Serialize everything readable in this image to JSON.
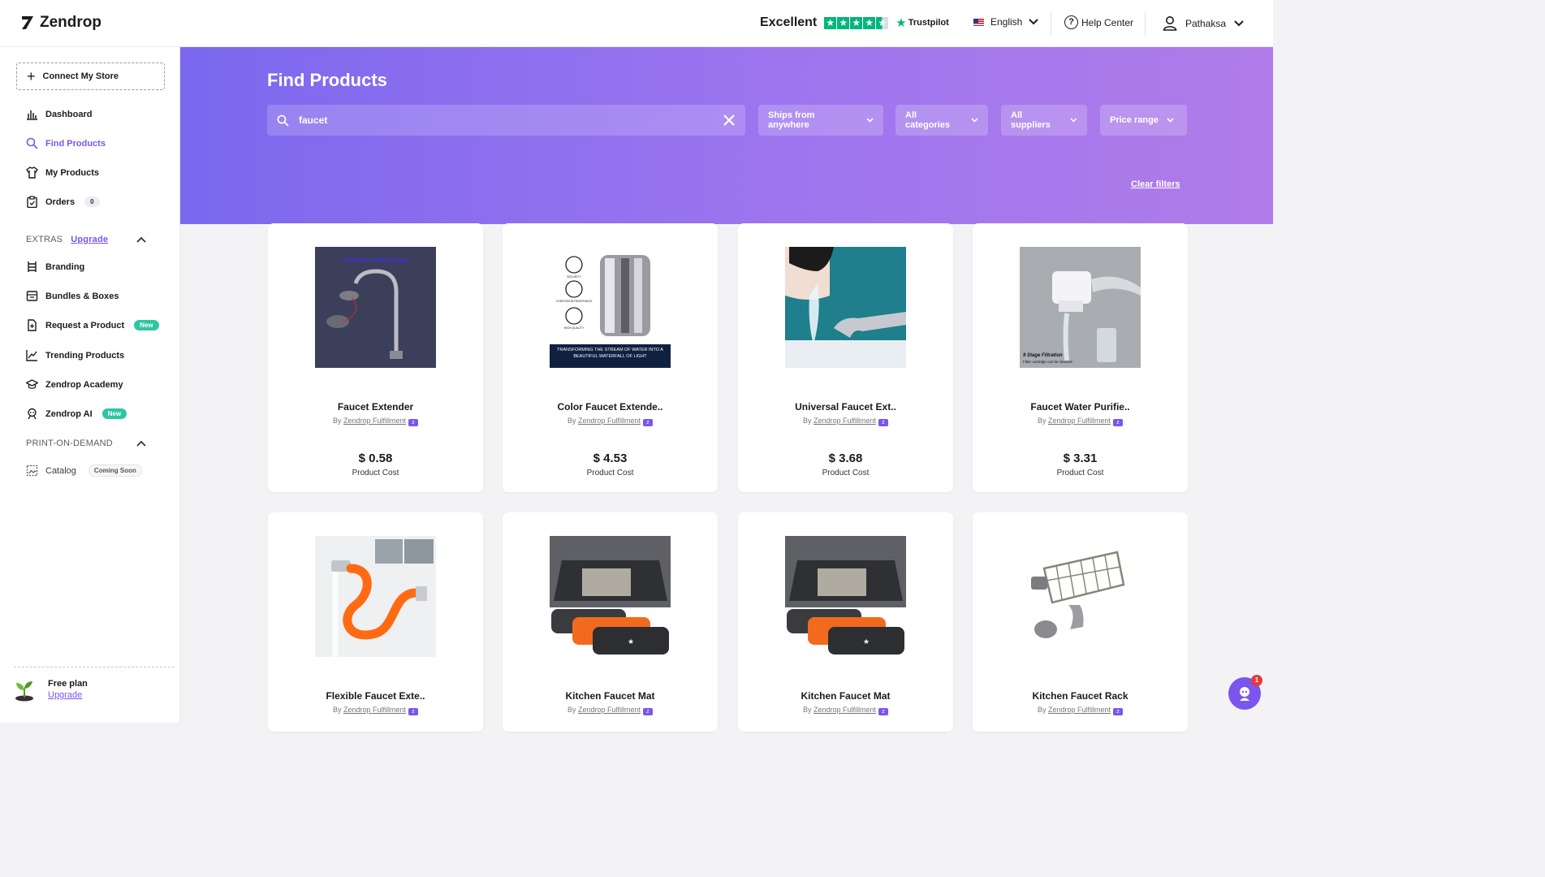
{
  "brand": {
    "name": "Zendrop"
  },
  "header": {
    "rating_word": "Excellent",
    "trustpilot": "Trustpilot",
    "language": "English",
    "help": "Help Center",
    "user": "Pathaksa"
  },
  "sidebar": {
    "connect": "Connect My Store",
    "nav": [
      {
        "label": "Dashboard",
        "icon": "bar-chart-icon"
      },
      {
        "label": "Find Products",
        "icon": "search-icon",
        "active": true
      },
      {
        "label": "My Products",
        "icon": "shirt-icon"
      },
      {
        "label": "Orders",
        "icon": "clipboard-icon",
        "badge": "0"
      }
    ],
    "extras_title": "EXTRAS",
    "extras_upgrade": "Upgrade",
    "extras": [
      {
        "label": "Branding",
        "icon": "branding-icon"
      },
      {
        "label": "Bundles & Boxes",
        "icon": "box-icon"
      },
      {
        "label": "Request a Product",
        "icon": "request-icon",
        "badge": "New"
      },
      {
        "label": "Trending Products",
        "icon": "trending-icon"
      },
      {
        "label": "Zendrop Academy",
        "icon": "academy-icon"
      },
      {
        "label": "Zendrop AI",
        "icon": "ai-icon",
        "badge": "New"
      }
    ],
    "pod_title": "PRINT-ON-DEMAND",
    "pod": [
      {
        "label": "Catalog",
        "icon": "catalog-icon",
        "badge": "Coming Soon"
      }
    ],
    "plan": {
      "title": "Free plan",
      "upgrade": "Upgrade"
    }
  },
  "main": {
    "title": "Find Products",
    "search_value": "faucet",
    "filters": [
      "Ships from anywhere",
      "All categories",
      "All suppliers",
      "Price range"
    ],
    "clear_filters": "Clear filters",
    "price_label": "Product Cost",
    "by_prefix": "By",
    "products": [
      {
        "name": "Faucet Extender",
        "supplier": "Zendrop Fulfillment",
        "price": "$ 0.58"
      },
      {
        "name": "Color Faucet Extende..",
        "supplier": "Zendrop Fulfillment",
        "price": "$ 4.53"
      },
      {
        "name": "Universal Faucet Ext..",
        "supplier": "Zendrop Fulfillment",
        "price": "$ 3.68"
      },
      {
        "name": "Faucet Water Purifie..",
        "supplier": "Zendrop Fulfillment",
        "price": "$ 3.31"
      },
      {
        "name": "Flexible Faucet Exte..",
        "supplier": "Zendrop Fulfillment"
      },
      {
        "name": "Kitchen Faucet Mat",
        "supplier": "Zendrop Fulfillment"
      },
      {
        "name": "Kitchen Faucet Mat",
        "supplier": "Zendrop Fulfillment"
      },
      {
        "name": "Kitchen Faucet Rack",
        "supplier": "Zendrop Fulfillment"
      }
    ],
    "image_text": {
      "p1_banner": "Universal rotating water",
      "p2_caption": "TRANSFORMING THE STREAM OF WATER INTO A BEAUTIFUL WATERFALL OF LIGHT",
      "p2_icons": [
        "SECURITY",
        "CORROSION RESISTANCE",
        "HIGH QUALITY"
      ],
      "p4_title": "9 Stage Filtration",
      "p4_sub": "Filter cartridge can be cleaned"
    }
  },
  "chat_badge": "1",
  "colors": {
    "accent": "#7a55ee",
    "trustpilot": "#00b67a",
    "new_badge": "#2fc5a2"
  }
}
